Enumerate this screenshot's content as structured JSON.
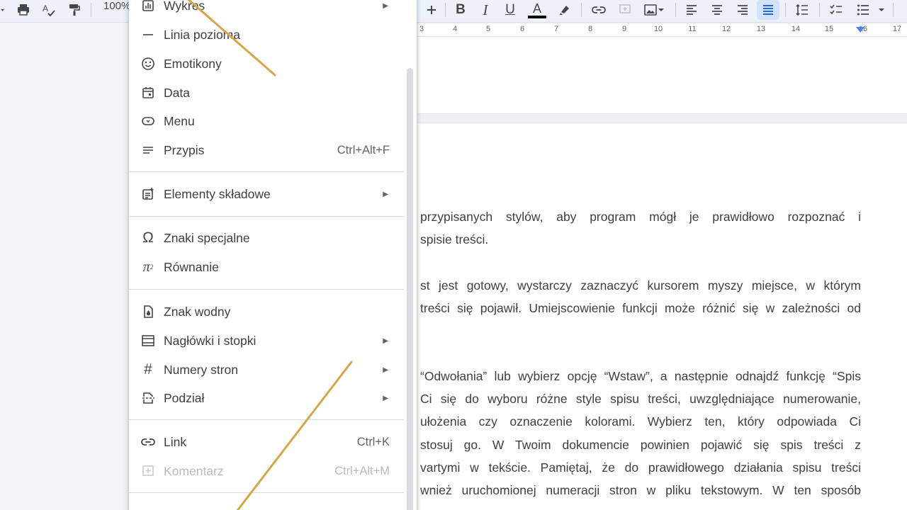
{
  "toolbar": {
    "zoom": "100%",
    "icons": [
      "print-icon",
      "spellcheck-icon",
      "paint-format-icon",
      "chart-icon",
      "increase-font-icon",
      "bold-icon",
      "italic-icon",
      "underline-icon",
      "text-color-icon",
      "highlight-icon",
      "link-icon",
      "comment-icon",
      "image-icon",
      "align-left-icon",
      "align-center-icon",
      "align-right-icon",
      "justify-icon",
      "line-spacing-icon",
      "checklist-icon",
      "bulleted-list-icon"
    ],
    "bold": "B",
    "italic": "I",
    "underline": "U",
    "text_color": "A",
    "text_color_value": "#000000"
  },
  "ruler": {
    "numbers": [
      "3",
      "4",
      "5",
      "6",
      "7",
      "8",
      "9",
      "10",
      "11",
      "12",
      "13",
      "14",
      "15",
      "16",
      "17"
    ]
  },
  "menu": {
    "items": [
      {
        "label": "Wykres",
        "icon": "chart-icon",
        "shortcut": "",
        "submenu": true,
        "disabled": false
      },
      {
        "label": "Linia pozioma",
        "icon": "horizontal-line-icon",
        "shortcut": "",
        "submenu": false,
        "disabled": false
      },
      {
        "label": "Emotikony",
        "icon": "emoji-icon",
        "shortcut": "",
        "submenu": false,
        "disabled": false
      },
      {
        "label": "Data",
        "icon": "calendar-icon",
        "shortcut": "",
        "submenu": false,
        "disabled": false
      },
      {
        "label": "Menu",
        "icon": "dropdown-chip-icon",
        "shortcut": "",
        "submenu": false,
        "disabled": false
      },
      {
        "label": "Przypis",
        "icon": "footnote-icon",
        "shortcut": "Ctrl+Alt+F",
        "submenu": false,
        "disabled": false
      },
      {
        "label": "Elementy składowe",
        "icon": "building-blocks-icon",
        "shortcut": "",
        "submenu": true,
        "disabled": false
      },
      {
        "label": "Znaki specjalne",
        "icon": "omega-icon",
        "shortcut": "",
        "submenu": false,
        "disabled": false
      },
      {
        "label": "Równanie",
        "icon": "pi-squared-icon",
        "shortcut": "",
        "submenu": false,
        "disabled": false
      },
      {
        "label": "Znak wodny",
        "icon": "watermark-icon",
        "shortcut": "",
        "submenu": false,
        "disabled": false
      },
      {
        "label": "Nagłówki i stopki",
        "icon": "header-footer-icon",
        "shortcut": "",
        "submenu": true,
        "disabled": false
      },
      {
        "label": "Numery stron",
        "icon": "hash-icon",
        "shortcut": "",
        "submenu": true,
        "disabled": false
      },
      {
        "label": "Podział",
        "icon": "page-break-icon",
        "shortcut": "",
        "submenu": true,
        "disabled": false
      },
      {
        "label": "Link",
        "icon": "link-icon",
        "shortcut": "Ctrl+K",
        "submenu": false,
        "disabled": false
      },
      {
        "label": "Komentarz",
        "icon": "add-comment-icon",
        "shortcut": "Ctrl+Alt+M",
        "submenu": false,
        "disabled": true
      }
    ]
  },
  "document": {
    "lines": [
      "przypisanych stylów, aby program mógł je prawidłowo rozpoznać i",
      "spisie treści.",
      "st jest gotowy, wystarczy zaznaczyć kursorem myszy miejsce, w którym",
      "treści się pojawił. Umiejscowienie funkcji może różnić się w zależności od",
      "“Odwołania” lub wybierz opcję “Wstaw”, a następnie odnajdź funkcję “Spis",
      "Ci się do wyboru różne style spisu treści, uwzględniające numerowanie,",
      "ułożenia czy oznaczenie kolorami. Wybierz ten, który odpowiada Ci",
      "stosuj go. W Twoim dokumencie powinien pojawić się spis treści z",
      "vartymi w tekście. Pamiętaj, że do prawidłowego działania spisu treści",
      "wnież uruchomionej numeracji stron w pliku tekstowym. W ten sposób"
    ]
  },
  "annotation_color": "#d4a64a"
}
